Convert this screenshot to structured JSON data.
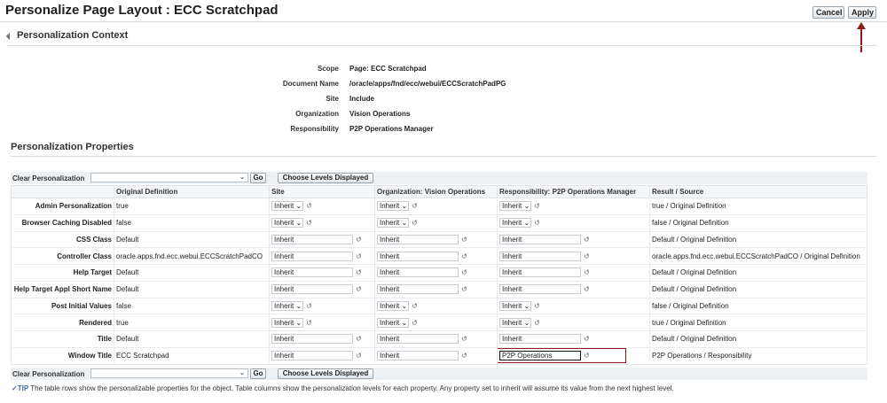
{
  "header": {
    "title": "Personalize Page Layout : ECC Scratchpad",
    "cancel_label": "Cancel",
    "apply_label": "Apply"
  },
  "context": {
    "heading": "Personalization Context",
    "rows": [
      {
        "label": "Scope",
        "value": "Page: ECC Scratchpad"
      },
      {
        "label": "Document Name",
        "value": "/oracle/apps/fnd/ecc/webui/ECCScratchPadPG"
      },
      {
        "label": "Site",
        "value": "Include"
      },
      {
        "label": "Organization",
        "value": "Vision Operations"
      },
      {
        "label": "Responsibility",
        "value": "P2P Operations Manager"
      }
    ]
  },
  "properties": {
    "heading": "Personalization Properties",
    "toolbar": {
      "clear_label": "Clear Personalization",
      "go_label": "Go",
      "levels_label": "Choose Levels Displayed"
    },
    "columns": [
      "",
      "Original Definition",
      "Site",
      "Organization: Vision Operations",
      "Responsibility: P2P Operations Manager",
      "Result / Source"
    ],
    "rows": [
      {
        "name": "Admin Personalization",
        "original": "true",
        "type": "select",
        "site": "Inherit",
        "org": "Inherit",
        "resp": "Inherit",
        "result": "true / Original Definition"
      },
      {
        "name": "Browser Caching Disabled",
        "original": "false",
        "type": "select",
        "site": "Inherit",
        "org": "Inherit",
        "resp": "Inherit",
        "result": "false / Original Definition"
      },
      {
        "name": "CSS Class",
        "original": "Default",
        "type": "text",
        "site": "Inherit",
        "org": "Inherit",
        "resp": "Inherit",
        "result": "Default / Original Definition"
      },
      {
        "name": "Controller Class",
        "original": "oracle.apps.fnd.ecc.webui.ECCScratchPadCO",
        "type": "text",
        "site": "Inherit",
        "org": "Inherit",
        "resp": "Inherit",
        "result": "oracle.apps.fnd.ecc.webui.ECCScratchPadCO / Original Definition"
      },
      {
        "name": "Help Target",
        "original": "Default",
        "type": "text",
        "site": "Inherit",
        "org": "Inherit",
        "resp": "Inherit",
        "result": "Default / Original Definition"
      },
      {
        "name": "Help Target Appl Short Name",
        "original": "Default",
        "type": "text",
        "site": "Inherit",
        "org": "Inherit",
        "resp": "Inherit",
        "result": "Default / Original Definition"
      },
      {
        "name": "Post Initial Values",
        "original": "false",
        "type": "select",
        "site": "Inherit",
        "org": "Inherit",
        "resp": "Inherit",
        "result": "false / Original Definition"
      },
      {
        "name": "Rendered",
        "original": "true",
        "type": "select",
        "site": "Inherit",
        "org": "Inherit",
        "resp": "Inherit",
        "result": "true / Original Definition"
      },
      {
        "name": "Title",
        "original": "Default",
        "type": "text",
        "site": "Inherit",
        "org": "Inherit",
        "resp": "Inherit",
        "result": "Default / Original Definition"
      },
      {
        "name": "Window Title",
        "original": "ECC Scratchpad",
        "type": "text",
        "site": "Inherit",
        "org": "Inherit",
        "resp": "P2P Operations",
        "result": "P2P Operations / Responsibility"
      }
    ]
  },
  "tip": {
    "label": "TIP",
    "text": "The table rows show the personalizable properties for the object. Table columns show the personalization levels for each property. Any property set to inherit will assume its value from the next highest level."
  },
  "colors": {
    "accent": "#8b1a1a",
    "link": "#3a6fb0"
  },
  "icons": [
    "collapse-triangle-icon",
    "dropdown-chevron-icon",
    "revert-icon",
    "tip-check-icon",
    "up-arrow-annotation-icon"
  ]
}
